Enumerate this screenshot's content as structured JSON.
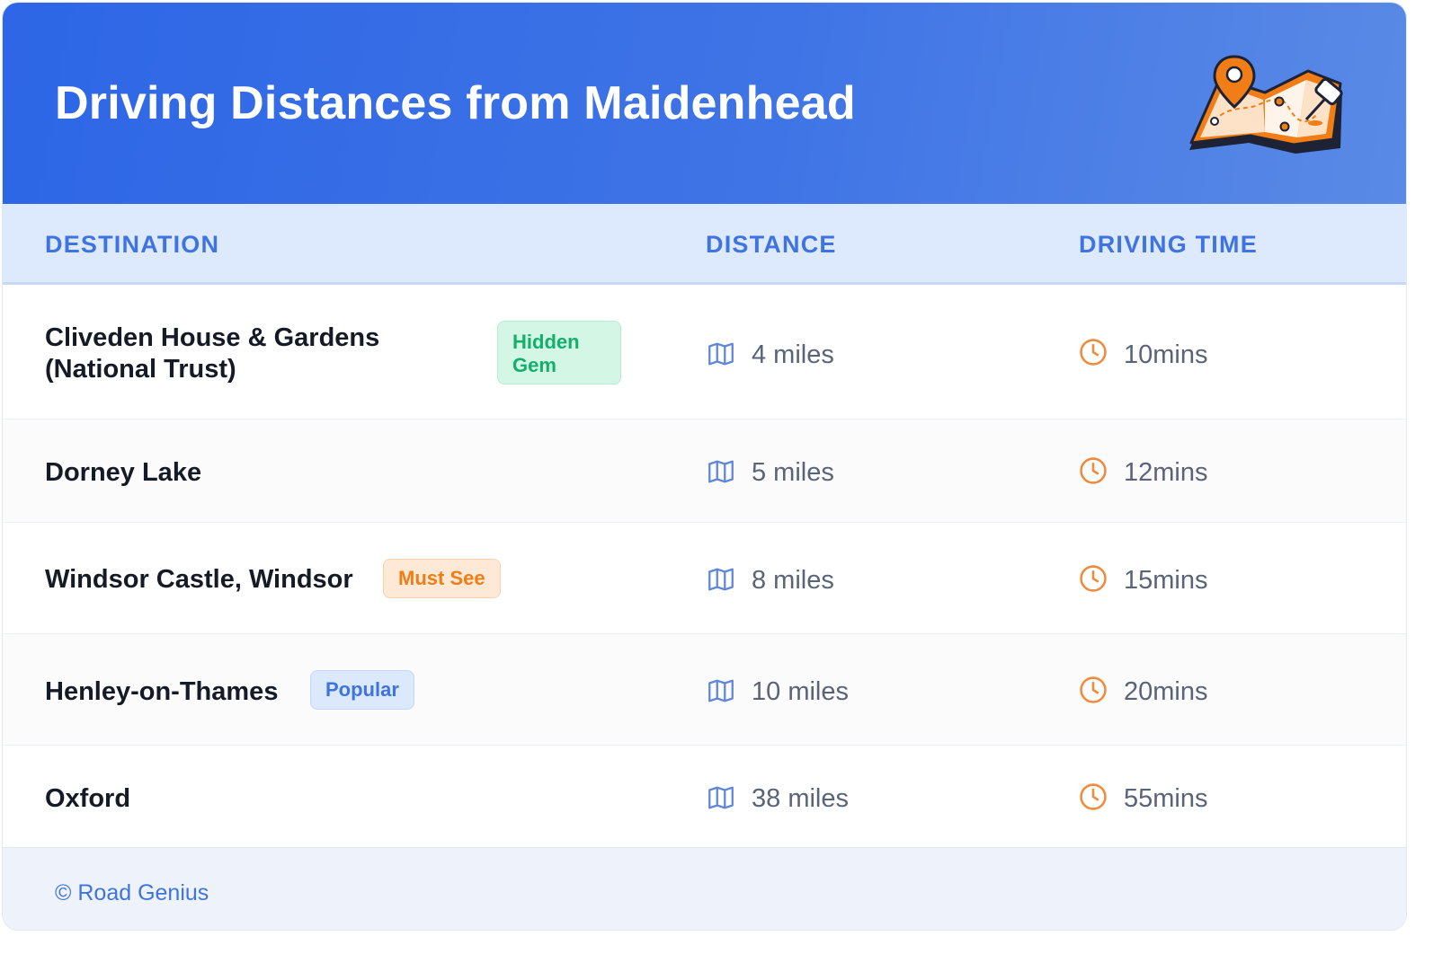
{
  "header": {
    "title": "Driving Distances from Maidenhead",
    "illustration_icon": "map-with-pins-icon"
  },
  "table": {
    "columns": [
      "DESTINATION",
      "DISTANCE",
      "DRIVING TIME"
    ],
    "rows": [
      {
        "destination": "Cliveden House & Gardens\n(National Trust)",
        "badge": "Hidden\nGem",
        "badge_color": "#12b06c",
        "distance": "4 miles",
        "time": "10mins"
      },
      {
        "destination": "Dorney Lake",
        "badge": "",
        "distance": "5 miles",
        "time": "12mins"
      },
      {
        "destination": "Windsor Castle, Windsor",
        "badge": "Must See",
        "badge_color": "#f07d16",
        "distance": "8 miles",
        "time": "15mins"
      },
      {
        "destination": "Henley-on-Thames",
        "badge": "Popular",
        "badge_color": "#3f74e0",
        "distance": "10 miles",
        "time": "20mins"
      },
      {
        "destination": "Oxford",
        "badge": "",
        "distance": "38 miles",
        "time": "55mins"
      }
    ],
    "distance_icon": "map-icon",
    "time_icon": "clock-icon"
  },
  "footer": {
    "credit": "© Road Genius"
  },
  "colors": {
    "header_gradient_start": "#2d66e6",
    "header_gradient_end": "#5a8ae6",
    "accent_blue": "#3f74e0",
    "clock_orange": "#f08a3c"
  }
}
